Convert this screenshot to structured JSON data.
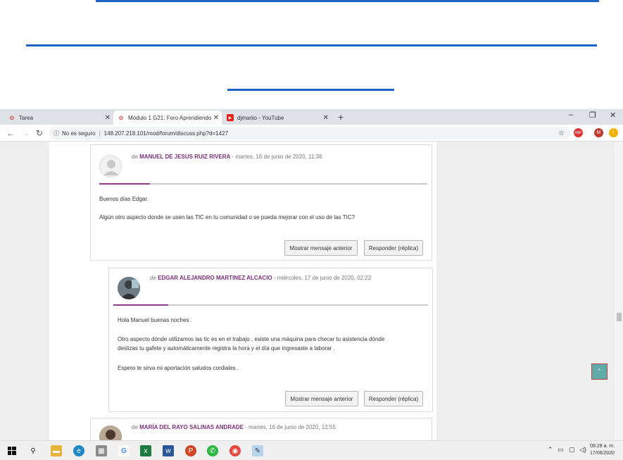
{
  "browser": {
    "tabs": [
      {
        "label": "Tarea",
        "icon": "moodle-icon"
      },
      {
        "label": "Módulo 1 G21: Foro Aprendiendo",
        "icon": "moodle-icon"
      },
      {
        "label": "djmariio - YouTube",
        "icon": "youtube-icon"
      }
    ],
    "new_tab": "+",
    "window_controls": {
      "minimize": "–",
      "restore": "❐",
      "close": "✕"
    },
    "security_label": "No es seguro",
    "url": "148.207.218.101/mod/forum/discuss.php?d=1427",
    "profile_initial": "M",
    "ext_label": "ABP"
  },
  "posts": [
    {
      "prefix": "de",
      "author": "MANUEL DE JESUS RUIZ RIVERA",
      "date": "- martes, 16 de junio de 2020, 11:36",
      "lines": [
        "Buenos días Edgar.",
        "Algún otro aspecto donde se usen las TIC en tu comunidad o se pueda mejorar con el uso de las TIC?"
      ],
      "btn_prev": "Mostrar mensaje anterior",
      "btn_reply": "Responder (réplica)"
    },
    {
      "prefix": "de",
      "author": "EDGAR ALEJANDRO MARTINEZ ALCACIO",
      "date": "- miércoles, 17 de junio de 2020, 02:22",
      "lines": [
        "Hola Manuel buenas noches .",
        "Otro aspecto dónde utilizamos las tic es en el trabajo , existe una máquina para checar tu asistencia dónde",
        "deslizas tu gafete y automáticamente registra la hora y el día que ingresaste a laborar .",
        "Espero te sirva mi aportación saludos cordiales ."
      ],
      "btn_prev": "Mostrar mensaje anterior",
      "btn_reply": "Responder (réplica)"
    },
    {
      "prefix": "de",
      "author": "MARÍA DEL RAYO SALINAS ANDRADE",
      "date": "- martes, 16 de junio de 2020, 12:55"
    }
  ],
  "taskbar": {
    "time": "09:29 a. m.",
    "date": "17/06/2020"
  },
  "colors": {
    "accent": "#8e3a8b",
    "rule": "#1f64c4"
  }
}
